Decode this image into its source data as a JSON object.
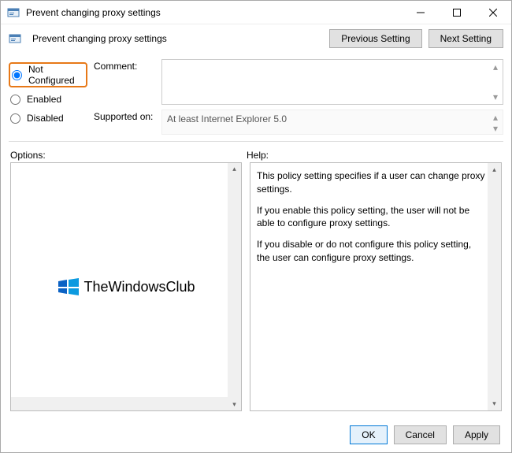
{
  "window": {
    "title": "Prevent changing proxy settings"
  },
  "header": {
    "title": "Prevent changing proxy settings",
    "previous": "Previous Setting",
    "next": "Next Setting"
  },
  "state": {
    "options": [
      {
        "key": "not_configured",
        "label": "Not Configured",
        "selected": true,
        "highlighted": true
      },
      {
        "key": "enabled",
        "label": "Enabled",
        "selected": false,
        "highlighted": false
      },
      {
        "key": "disabled",
        "label": "Disabled",
        "selected": false,
        "highlighted": false
      }
    ]
  },
  "comment": {
    "label": "Comment:",
    "value": ""
  },
  "supported": {
    "label": "Supported on:",
    "value": "At least Internet Explorer 5.0"
  },
  "section_labels": {
    "options": "Options:",
    "help": "Help:"
  },
  "help": {
    "p1": "This policy setting specifies if a user can change proxy settings.",
    "p2": "If you enable this policy setting, the user will not be able to configure proxy settings.",
    "p3": "If you disable or do not configure this policy setting, the user can configure proxy settings."
  },
  "watermark": {
    "text": "TheWindowsClub"
  },
  "footer": {
    "ok": "OK",
    "cancel": "Cancel",
    "apply": "Apply"
  }
}
